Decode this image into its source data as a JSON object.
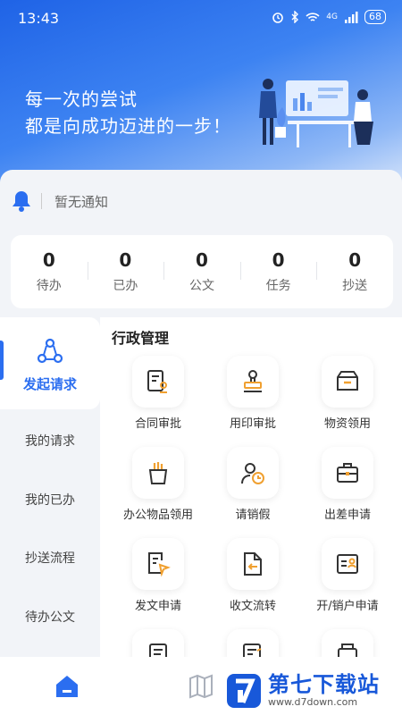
{
  "status_bar": {
    "time": "13:43",
    "network": "4G",
    "battery": "68"
  },
  "hero": {
    "slogan_line1": "每一次的尝试",
    "slogan_line2": "都是向成功迈进的一步！"
  },
  "notice": {
    "text": "暂无通知"
  },
  "stats": [
    {
      "value": "0",
      "label": "待办"
    },
    {
      "value": "0",
      "label": "已办"
    },
    {
      "value": "0",
      "label": "公文"
    },
    {
      "value": "0",
      "label": "任务"
    },
    {
      "value": "0",
      "label": "抄送"
    }
  ],
  "sidebar": {
    "active_label": "发起请求",
    "items": [
      "我的请求",
      "我的已办",
      "抄送流程",
      "待办公文"
    ]
  },
  "section": {
    "title": "行政管理",
    "items": [
      {
        "label": "合同审批",
        "icon": "contract-icon"
      },
      {
        "label": "用印审批",
        "icon": "seal-icon"
      },
      {
        "label": "物资领用",
        "icon": "box-icon"
      },
      {
        "label": "办公物品领用",
        "icon": "pen-holder-icon"
      },
      {
        "label": "请销假",
        "icon": "leave-clock-icon"
      },
      {
        "label": "出差申请",
        "icon": "briefcase-icon"
      },
      {
        "label": "发文申请",
        "icon": "send-document-icon"
      },
      {
        "label": "收文流转",
        "icon": "receive-document-icon"
      },
      {
        "label": "开/销户申请",
        "icon": "account-icon"
      }
    ]
  },
  "tabbar": {
    "items": [
      "home-icon",
      "map-icon"
    ]
  },
  "watermark": {
    "title": "第七下载站",
    "url": "www.d7down.com"
  },
  "colors": {
    "accent": "#2b6ef0",
    "orange": "#f0a030",
    "hero_top": "#1f63e6"
  }
}
